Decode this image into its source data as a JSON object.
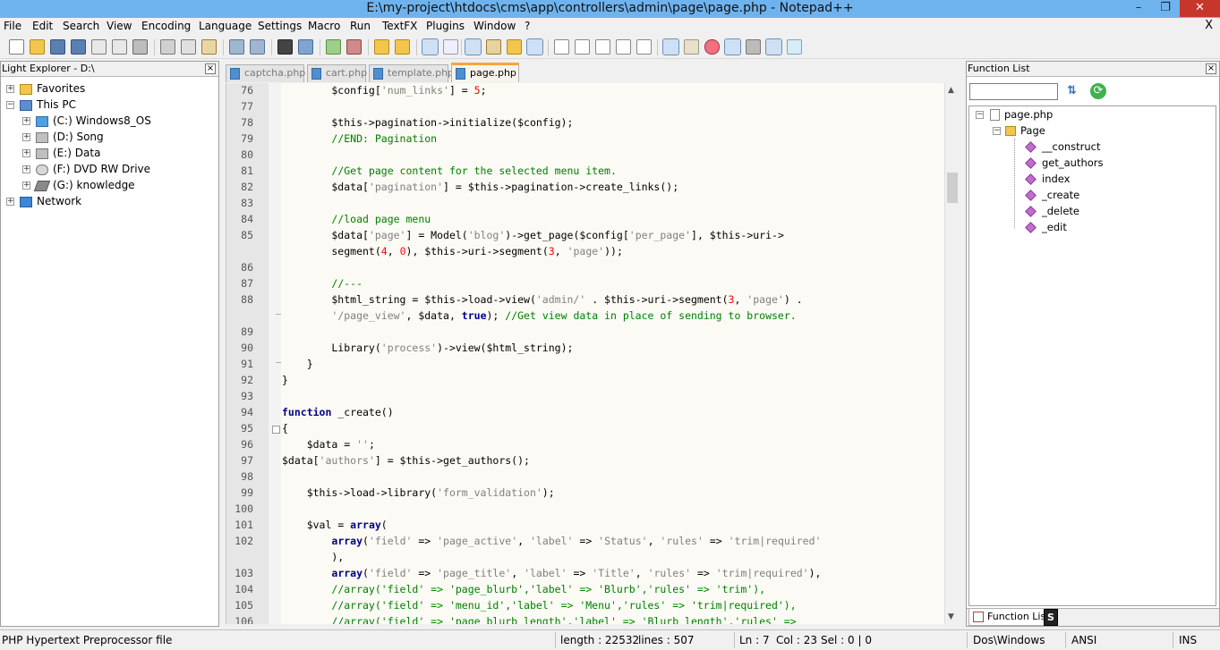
{
  "window": {
    "title": "E:\\my-project\\htdocs\\cms\\app\\controllers\\admin\\page\\page.php - Notepad++",
    "minimize": "–",
    "maximize": "❐",
    "close": "✕"
  },
  "menu": [
    "File",
    "Edit",
    "Search",
    "View",
    "Encoding",
    "Language",
    "Settings",
    "Macro",
    "Run",
    "TextFX",
    "Plugins",
    "Window",
    "?"
  ],
  "menu_close": "X",
  "left_panel": {
    "title": "Light Explorer - D:\\",
    "close": "×",
    "tree": [
      {
        "label": "Favorites",
        "level": 0,
        "expander": "+"
      },
      {
        "label": "This PC",
        "level": 0,
        "expander": "−"
      },
      {
        "label": "(C:) Windows8_OS",
        "level": 1,
        "expander": "+"
      },
      {
        "label": "(D:) Song",
        "level": 1,
        "expander": "+"
      },
      {
        "label": "(E:) Data",
        "level": 1,
        "expander": "+"
      },
      {
        "label": "(F:) DVD RW Drive",
        "level": 1,
        "expander": "+"
      },
      {
        "label": "(G:) knowledge",
        "level": 1,
        "expander": "+"
      },
      {
        "label": "Network",
        "level": 0,
        "expander": "+"
      }
    ]
  },
  "tabs": [
    {
      "label": "captcha.php",
      "active": false
    },
    {
      "label": "cart.php",
      "active": false
    },
    {
      "label": "template.php",
      "active": false
    },
    {
      "label": "page.php",
      "active": true
    }
  ],
  "editor": {
    "lines": [
      {
        "n": "76",
        "code": "        $config['num_links'] = 5;"
      },
      {
        "n": "77",
        "code": ""
      },
      {
        "n": "78",
        "code": "        $this->pagination->initialize($config);"
      },
      {
        "n": "79",
        "code": "        //END: Pagination"
      },
      {
        "n": "80",
        "code": ""
      },
      {
        "n": "81",
        "code": "        //Get page content for the selected menu item."
      },
      {
        "n": "82",
        "code": "        $data['pagination'] = $this->pagination->create_links();"
      },
      {
        "n": "83",
        "code": ""
      },
      {
        "n": "84",
        "code": "        //load page menu"
      },
      {
        "n": "85",
        "code": "        $data['page'] = Model('blog')->get_page($config['per_page'], $this->uri->"
      },
      {
        "n": "",
        "code": "        segment(4, 0), $this->uri->segment(3, 'page'));"
      },
      {
        "n": "86",
        "code": ""
      },
      {
        "n": "87",
        "code": "        //---"
      },
      {
        "n": "88",
        "code": "        $html_string = $this->load->view('admin/' . $this->uri->segment(3, 'page') ."
      },
      {
        "n": "",
        "code": "        '/page_view', $data, true); //Get view data in place of sending to browser."
      },
      {
        "n": "89",
        "code": ""
      },
      {
        "n": "90",
        "code": "        Library('process')->view($html_string);"
      },
      {
        "n": "91",
        "code": "    }"
      },
      {
        "n": "92",
        "code": "}"
      },
      {
        "n": "93",
        "code": ""
      },
      {
        "n": "94",
        "code": "function _create()"
      },
      {
        "n": "95",
        "code": "{"
      },
      {
        "n": "96",
        "code": "    $data = '';"
      },
      {
        "n": "97",
        "code": "$data['authors'] = $this->get_authors();"
      },
      {
        "n": "98",
        "code": ""
      },
      {
        "n": "99",
        "code": "    $this->load->library('form_validation');"
      },
      {
        "n": "100",
        "code": ""
      },
      {
        "n": "101",
        "code": "    $val = array("
      },
      {
        "n": "102",
        "code": "        array('field' => 'page_active', 'label' => 'Status', 'rules' => 'trim|required'"
      },
      {
        "n": "",
        "code": "        ),"
      },
      {
        "n": "103",
        "code": "        array('field' => 'page_title', 'label' => 'Title', 'rules' => 'trim|required'),"
      },
      {
        "n": "104",
        "code": "        //array('field' => 'page_blurb','label' => 'Blurb','rules' => 'trim'),"
      },
      {
        "n": "105",
        "code": "        //array('field' => 'menu_id','label' => 'Menu','rules' => 'trim|required'),"
      },
      {
        "n": "106",
        "code": "        //array('field' => 'page_blurb_length','label' => 'Blurb length','rules' =>"
      }
    ]
  },
  "function_list": {
    "title": "Function List",
    "close": "×",
    "search_value": "",
    "file": "page.php",
    "class": "Page",
    "methods": [
      "__construct",
      "get_authors",
      "index",
      "_create",
      "_delete",
      "_edit"
    ],
    "tabs": [
      "Function List",
      "S"
    ]
  },
  "status": {
    "file_type": "PHP Hypertext Preprocessor file",
    "length": "length : 22532",
    "lines": "lines : 507",
    "ln": "Ln : 7",
    "col": "Col : 23",
    "sel": "Sel : 0 | 0",
    "eol": "Dos\\Windows",
    "encoding": "ANSI",
    "mode": "INS"
  },
  "colors": {
    "accent": "#f7a53a",
    "title_bar": "#6fb3ee",
    "keyword": "#00008b",
    "comment": "#008000",
    "string": "#808080",
    "number": "#ff0000"
  }
}
